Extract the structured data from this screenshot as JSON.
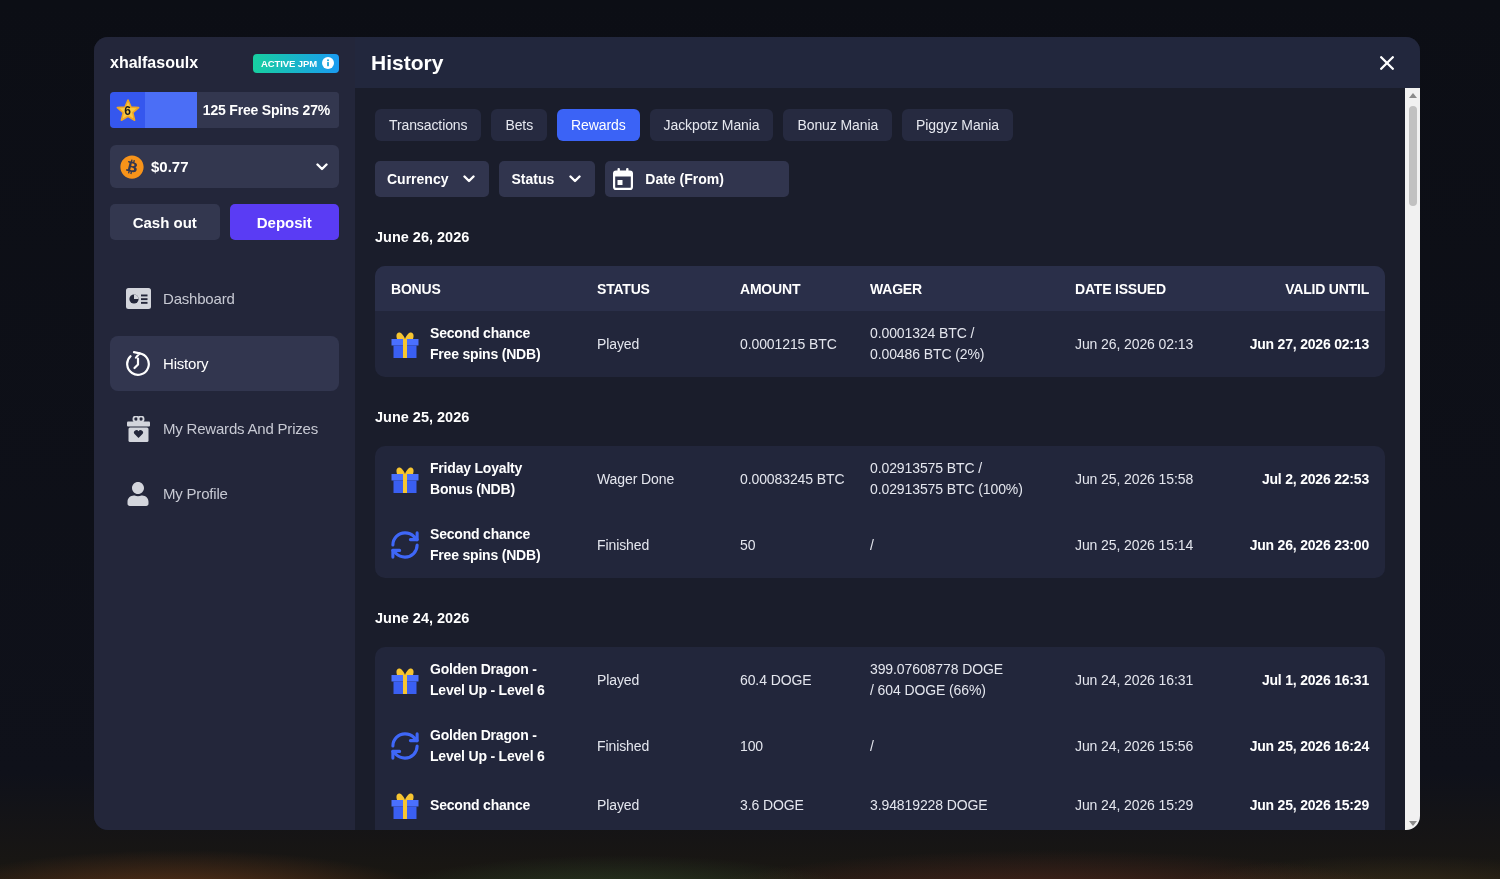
{
  "sidebar": {
    "username": "xhalfasoulx",
    "badge": {
      "label": "ACTIVE JPM"
    },
    "progress": {
      "level_number": "6",
      "label": "125 Free Spins 27%",
      "level": 0.27
    },
    "balance": {
      "value": "$0.77"
    },
    "buttons": [
      {
        "label": "Cash out",
        "kind": "secondary"
      },
      {
        "label": "Deposit",
        "kind": "primary"
      }
    ],
    "nav": [
      {
        "label": "Dashboard",
        "selected": false
      },
      {
        "label": "History",
        "selected": true
      },
      {
        "label": "My Rewards And Prizes",
        "selected": false
      },
      {
        "label": "My Profile",
        "selected": false
      }
    ]
  },
  "header": {
    "title": "History"
  },
  "tabs": [
    {
      "label": "Transactions",
      "selected": false
    },
    {
      "label": "Bets",
      "selected": false
    },
    {
      "label": "Rewards",
      "selected": true
    },
    {
      "label": "Jackpotz Mania",
      "selected": false
    },
    {
      "label": "Bonuz Mania",
      "selected": false
    },
    {
      "label": "Piggyz Mania",
      "selected": false
    }
  ],
  "filters": [
    {
      "label": "Currency",
      "kind": "dropdown"
    },
    {
      "label": "Status",
      "kind": "dropdown"
    },
    {
      "label": "Date (From)",
      "kind": "date"
    }
  ],
  "table": {
    "columns": [
      "BONUS",
      "STATUS",
      "AMOUNT",
      "WAGER",
      "DATE ISSUED",
      "VALID UNTIL"
    ],
    "groups": [
      {
        "date": "June 26, 2026",
        "rows": [
          {
            "kind": "gift",
            "bonus": "Second chance\nFree spins (NDB)",
            "status": "Played",
            "amount": "0.0001215 BTC",
            "wager": "0.0001324 BTC /\n0.00486 BTC (2%)",
            "date_issued": "Jun 26, 2026 02:13",
            "valid_until": "Jun 27, 2026 02:13"
          }
        ]
      },
      {
        "date": "June 25, 2026",
        "rows": [
          {
            "kind": "gift",
            "bonus": "Friday Loyalty\nBonus (NDB)",
            "status": "Wager Done",
            "amount": "0.00083245 BTC",
            "wager": "0.02913575 BTC /\n0.02913575 BTC (100%)",
            "date_issued": "Jun 25, 2026 15:58",
            "valid_until": "Jul 2, 2026 22:53"
          },
          {
            "kind": "renew",
            "bonus": "Second chance\nFree spins (NDB)",
            "status": "Finished",
            "amount": "50",
            "wager": "/",
            "date_issued": "Jun 25, 2026 15:14",
            "valid_until": "Jun 26, 2026 23:00"
          }
        ]
      },
      {
        "date": "June 24, 2026",
        "rows": [
          {
            "kind": "gift",
            "bonus": "Golden Dragon -\nLevel Up - Level 6",
            "status": "Played",
            "amount": "60.4 DOGE",
            "wager": "399.07608778 DOGE\n/ 604 DOGE (66%)",
            "date_issued": "Jun 24, 2026 16:31",
            "valid_until": "Jul 1, 2026 16:31"
          },
          {
            "kind": "renew",
            "bonus": "Golden Dragon -\nLevel Up - Level 6",
            "status": "Finished",
            "amount": "100",
            "wager": "/",
            "date_issued": "Jun 24, 2026 15:56",
            "valid_until": "Jun 25, 2026 16:24"
          },
          {
            "kind": "gift",
            "bonus": "Second chance",
            "status": "Played",
            "amount": "3.6 DOGE",
            "wager": "3.94819228 DOGE",
            "date_issued": "Jun 24, 2026 15:29",
            "valid_until": "Jun 25, 2026 15:29"
          }
        ]
      }
    ]
  }
}
